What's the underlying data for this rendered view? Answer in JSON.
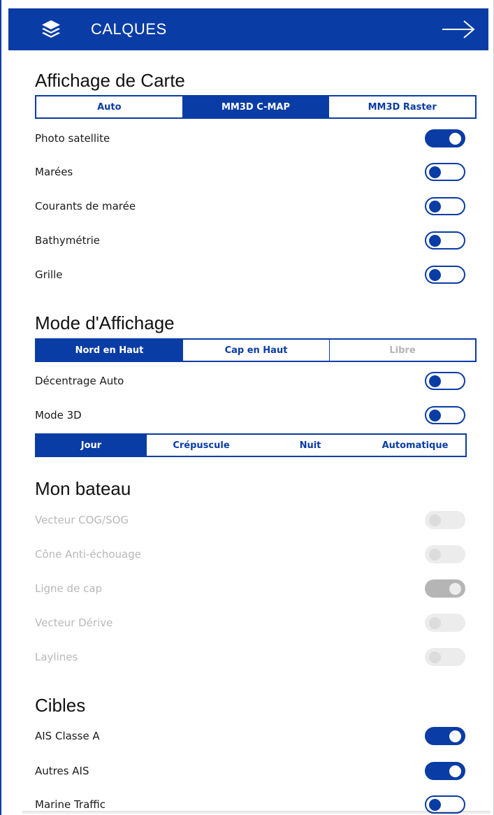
{
  "header": {
    "icon": "layers-icon",
    "title": "CALQUES",
    "close_icon": "arrow-right-icon"
  },
  "map_display": {
    "title": "Affichage de Carte",
    "options": [
      "Auto",
      "MM3D C-MAP",
      "MM3D Raster"
    ],
    "selected": "MM3D C-MAP",
    "toggles": [
      {
        "label": "Photo satellite",
        "on": true
      },
      {
        "label": "Marées",
        "on": false
      },
      {
        "label": "Courants de marée",
        "on": false
      },
      {
        "label": "Bathymétrie",
        "on": false
      },
      {
        "label": "Grille",
        "on": false
      }
    ]
  },
  "display_mode": {
    "title": "Mode d'Affichage",
    "orientation_options": [
      "Nord en Haut",
      "Cap en Haut",
      "Libre"
    ],
    "orientation_selected": "Nord en Haut",
    "orientation_disabled": [
      "Libre"
    ],
    "toggles": [
      {
        "label": "Décentrage Auto",
        "on": false
      },
      {
        "label": "Mode 3D",
        "on": false
      }
    ],
    "palette_options": [
      "Jour",
      "Crépuscule",
      "Nuit",
      "Automatique"
    ],
    "palette_selected": "Jour"
  },
  "my_boat": {
    "title": "Mon bateau",
    "toggles": [
      {
        "label": "Vecteur COG/SOG",
        "on": false,
        "disabled": true
      },
      {
        "label": "Cône Anti-échouage",
        "on": false,
        "disabled": true
      },
      {
        "label": "Ligne de cap",
        "on": true,
        "disabled": true
      },
      {
        "label": "Vecteur Dérive",
        "on": false,
        "disabled": true
      },
      {
        "label": "Laylines",
        "on": false,
        "disabled": true
      }
    ]
  },
  "targets": {
    "title": "Cibles",
    "toggles": [
      {
        "label": "AIS Classe A",
        "on": true
      },
      {
        "label": "Autres AIS",
        "on": true
      },
      {
        "label": "Marine Traffic",
        "on": false
      }
    ]
  },
  "colors": {
    "accent": "#0a3ca5",
    "disabled_text": "#b8b8b8",
    "disabled_toggle": "#ececec"
  }
}
